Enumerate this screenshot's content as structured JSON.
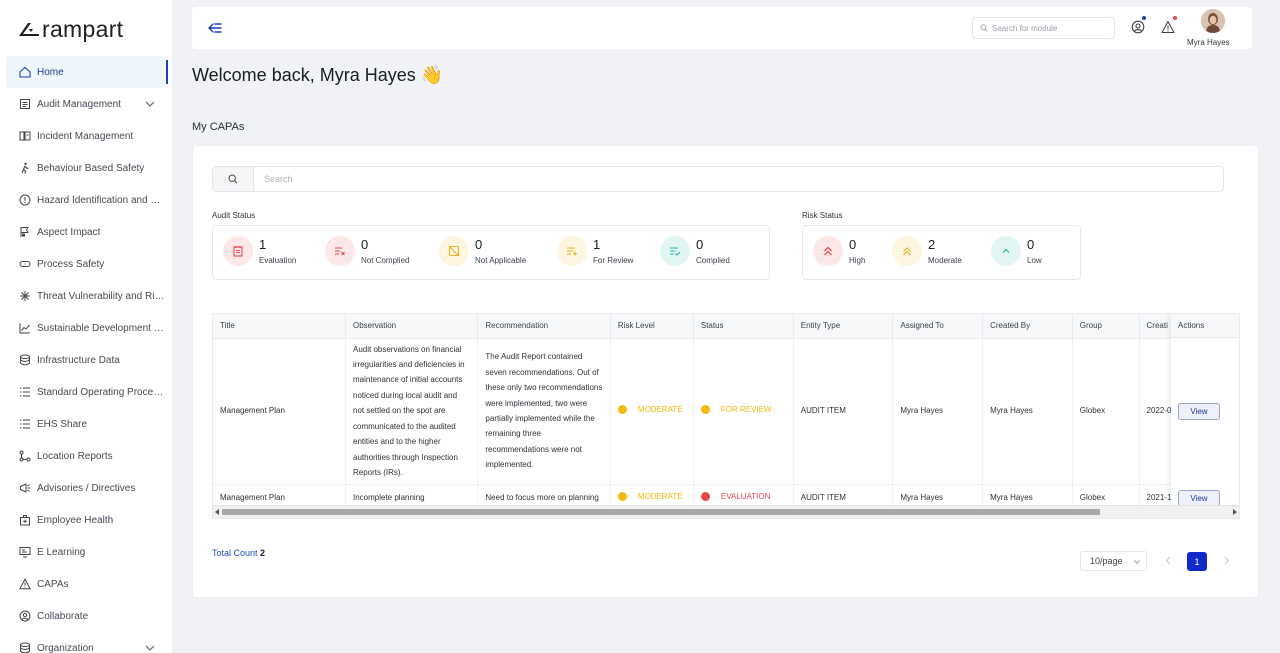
{
  "app": {
    "name": "rampart"
  },
  "sidebar": {
    "items": [
      {
        "label": "Home",
        "icon": "home-icon"
      },
      {
        "label": "Audit Management",
        "icon": "clipboard-icon"
      },
      {
        "label": "Incident Management",
        "icon": "incident-icon"
      },
      {
        "label": "Behaviour Based Safety",
        "icon": "walking-person-icon"
      },
      {
        "label": "Hazard Identification and Risk Assessment",
        "icon": "alert-circle-icon"
      },
      {
        "label": "Aspect Impact",
        "icon": "flag-icon"
      },
      {
        "label": "Process Safety",
        "icon": "goggles-icon"
      },
      {
        "label": "Threat Vulnerability and Risk Assessment",
        "icon": "spark-icon"
      },
      {
        "label": "Sustainable Development Report",
        "icon": "line-chart-icon"
      },
      {
        "label": "Infrastructure Data",
        "icon": "database-icon"
      },
      {
        "label": "Standard Operating Procedures",
        "icon": "list-icon"
      },
      {
        "label": "EHS Share",
        "icon": "share-list-icon"
      },
      {
        "label": "Location Reports",
        "icon": "location-nodes-icon"
      },
      {
        "label": "Advisories / Directives",
        "icon": "megaphone-icon"
      },
      {
        "label": "Employee Health",
        "icon": "health-bag-icon"
      },
      {
        "label": "E Learning",
        "icon": "elearning-icon"
      },
      {
        "label": "CAPAs",
        "icon": "warning-triangle-icon"
      },
      {
        "label": "Collaborate",
        "icon": "collaborate-icon"
      },
      {
        "label": "Organization",
        "icon": "organization-icon"
      }
    ]
  },
  "header": {
    "search_placeholder": "Search for module",
    "user_name": "Myra Hayes"
  },
  "welcome": "Welcome back, Myra Hayes 👋",
  "section_title": "My CAPAs",
  "search": {
    "placeholder": "Search"
  },
  "audit_status": {
    "label": "Audit Status",
    "items": [
      {
        "count": "1",
        "caption": "Evaluation",
        "color": "#e5484d",
        "bg": "#fde8e8"
      },
      {
        "count": "0",
        "caption": "Not Complied",
        "color": "#e5484d",
        "bg": "#fde8e8"
      },
      {
        "count": "0",
        "caption": "Not Applicable",
        "color": "#e8b22a",
        "bg": "#fdf5df"
      },
      {
        "count": "1",
        "caption": "For Review",
        "color": "#e8b22a",
        "bg": "#fdf5df"
      },
      {
        "count": "0",
        "caption": "Complied",
        "color": "#2bb5a0",
        "bg": "#e1f6f2"
      }
    ]
  },
  "risk_status": {
    "label": "Risk Status",
    "items": [
      {
        "count": "0",
        "caption": "High",
        "color": "#e5484d",
        "bg": "#fde8e8"
      },
      {
        "count": "2",
        "caption": "Moderate",
        "color": "#e8b22a",
        "bg": "#fdf5df"
      },
      {
        "count": "0",
        "caption": "Low",
        "color": "#2bb5a0",
        "bg": "#e1f6f2"
      }
    ]
  },
  "table": {
    "columns": [
      "Title",
      "Observation",
      "Recommendation",
      "Risk Level",
      "Status",
      "Entity Type",
      "Assigned To",
      "Created By",
      "Group",
      "Creati",
      "Actions"
    ],
    "rows": [
      {
        "title": "Management Plan",
        "observation": "Audit observations on financial irregularities and deficiencies in maintenance of initial accounts noticed during local audit and not settled on the spot are communicated to the audited entities and to the higher authorities through Inspection Reports (IRs).",
        "recommendation": "The Audit Report contained seven recommendations. Out of these only two recommendations were implemented, two were partially implemented while the remaining three recommendations were not implemented.",
        "risk_level": "MODERATE",
        "risk_color": "#f0b90b",
        "status": "FOR REVIEW",
        "status_color": "#f0b90b",
        "entity_type": "AUDIT ITEM",
        "assigned_to": "Myra Hayes",
        "created_by": "Myra Hayes",
        "group": "Globex",
        "created": "2022-0",
        "action": "View"
      },
      {
        "title": "Management Plan",
        "observation": "Incomplete planning",
        "recommendation": "Need to focus more on planning",
        "risk_level": "MODERATE",
        "risk_color": "#f0b90b",
        "status": "EVALUATION",
        "status_color": "#e5484d",
        "entity_type": "AUDIT ITEM",
        "assigned_to": "Myra Hayes",
        "created_by": "Myra Hayes",
        "group": "Globex",
        "created": "2021-1",
        "action": "View"
      }
    ]
  },
  "footer": {
    "total_label": "Total Count",
    "total_value": "2",
    "page_size": "10/page",
    "current_page": "1"
  }
}
